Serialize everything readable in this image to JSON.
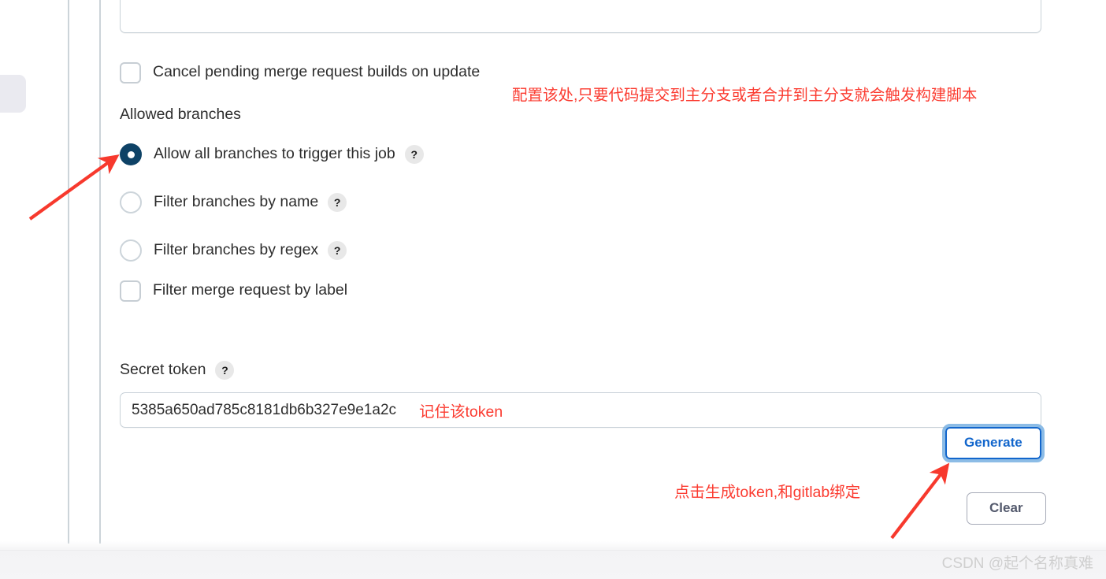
{
  "form": {
    "top_field": {
      "value": "",
      "placeholder": ""
    },
    "cancel_pending": {
      "label": "Cancel pending merge request builds on update",
      "checked": false
    },
    "allowed_branches_label": "Allowed branches",
    "branch_options": [
      {
        "label": "Allow all branches to trigger this job",
        "type": "radio",
        "checked": true,
        "help": "?"
      },
      {
        "label": "Filter branches by name",
        "type": "radio",
        "checked": false,
        "help": "?"
      },
      {
        "label": "Filter branches by regex",
        "type": "radio",
        "checked": false,
        "help": "?"
      },
      {
        "label": "Filter merge request by label",
        "type": "checkbox",
        "checked": false,
        "help": ""
      }
    ],
    "secret_token": {
      "label": "Secret token",
      "help": "?",
      "value": "5385a650ad785c8181db6b327e9e1a2c",
      "placeholder": ""
    },
    "buttons": {
      "generate": "Generate",
      "clear": "Clear"
    }
  },
  "annotations": [
    {
      "id": "top",
      "text": "配置该处,只要代码提交到主分支或者合并到主分支就会触发构建脚本"
    },
    {
      "id": "token",
      "text": "记住该token"
    },
    {
      "id": "generate",
      "text": "点击生成token,和gitlab绑定"
    }
  ],
  "watermark": "CSDN @起个名称真难",
  "colors": {
    "annotation_red": "#fb3b30",
    "radio_selected": "#0e4266",
    "generate_blue": "#1266cc",
    "clear_gray": "#545a6d",
    "border_gray": "#c8d1d8"
  }
}
